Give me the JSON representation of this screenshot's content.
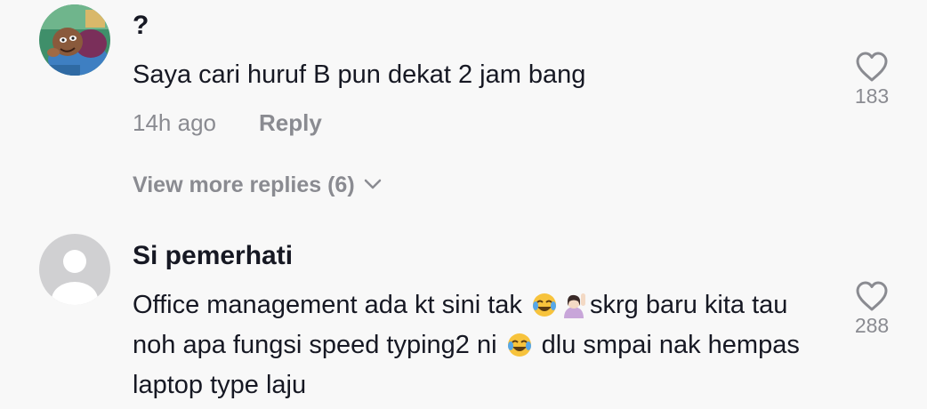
{
  "comments": [
    {
      "username": "?",
      "text": "Saya cari huruf B pun dekat 2 jam bang",
      "time": "14h ago",
      "reply_label": "Reply",
      "likes": "183",
      "avatar_icon": "cartoon-avatar"
    },
    {
      "username": "Si pemerhati",
      "text_parts": [
        "Office management ada kt sini tak ",
        "skrg baru kita tau noh apa fungsi speed typing2 ni ",
        " dlu smpai nak hempas laptop type laju"
      ],
      "emojis": [
        "face-with-tears-of-joy",
        "person-raising-hand",
        "face-with-tears-of-joy"
      ],
      "likes": "288",
      "avatar_icon": "default-avatar"
    }
  ],
  "view_more_replies": "View more replies (6)",
  "colors": {
    "background": "#f8f8f8",
    "text": "#161823",
    "muted": "#8a8b91"
  }
}
